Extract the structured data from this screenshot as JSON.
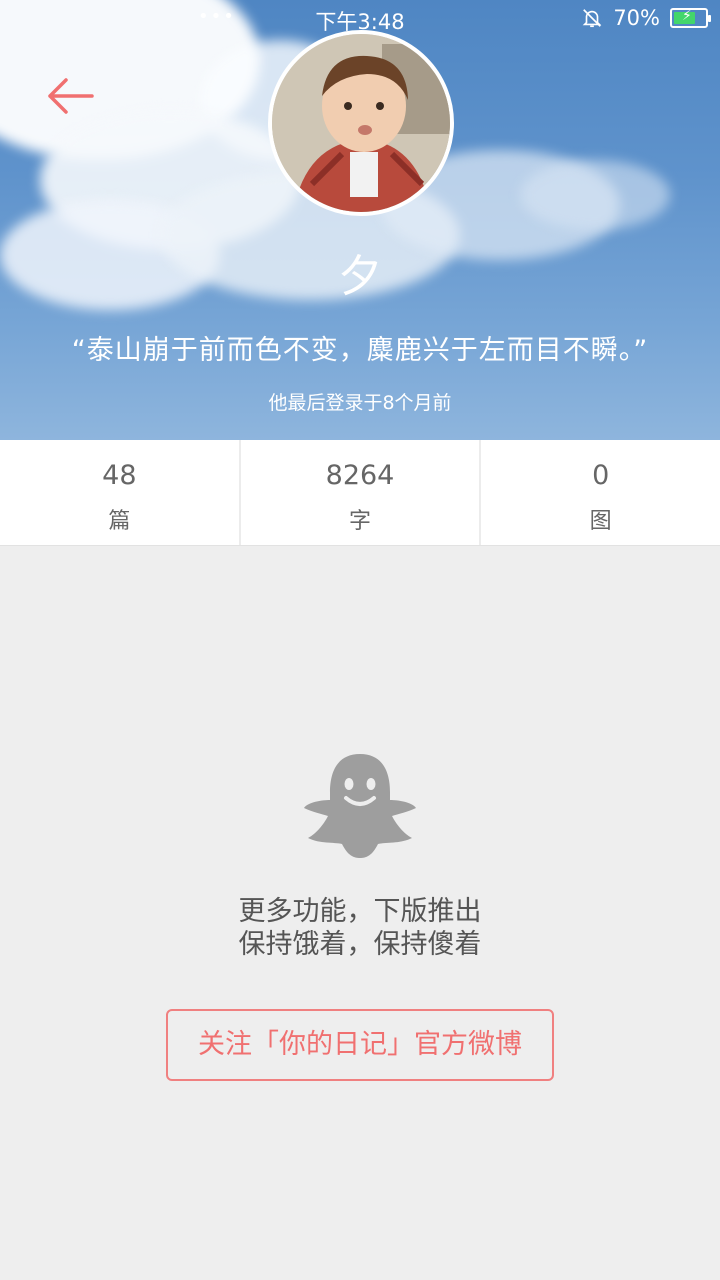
{
  "status_bar": {
    "dots": "•••",
    "time": "下午3:48",
    "battery": "70%",
    "battery_level": 0.7,
    "battery_color": "#43d66b",
    "icons": [
      "bell-off-icon",
      "battery-charging-icon"
    ]
  },
  "header": {
    "back_icon": "back-arrow-icon",
    "accent_color": "#f07070",
    "username": "夕",
    "motto": "“泰山崩于前而色不变，麋鹿兴于左而目不瞬。”",
    "last_login": "他最后登录于8个月前"
  },
  "stats": [
    {
      "value": "48",
      "label": "篇"
    },
    {
      "value": "8264",
      "label": "字"
    },
    {
      "value": "0",
      "label": "图"
    }
  ],
  "empty_state": {
    "icon": "ghost-icon",
    "line1": "更多功能，下版推出",
    "line2": "保持饿着，保持傻着"
  },
  "follow_button": {
    "label": "关注「你的日记」官方微博"
  }
}
